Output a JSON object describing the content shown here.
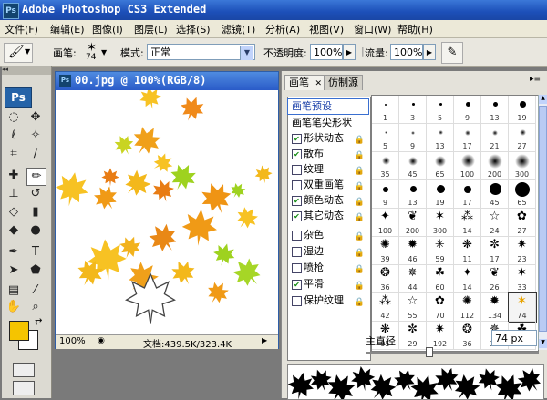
{
  "titlebar": {
    "logo": "Ps",
    "title": "Adobe Photoshop CS3 Extended"
  },
  "menu": [
    "文件(F)",
    "编辑(E)",
    "图像(I)",
    "图层(L)",
    "选择(S)",
    "滤镜(T)",
    "分析(A)",
    "视图(V)",
    "窗口(W)",
    "帮助(H)"
  ],
  "options": {
    "brush_label": "画笔:",
    "brush_size": "74",
    "mode_label": "模式:",
    "mode_value": "正常",
    "opacity_label": "不透明度:",
    "opacity_value": "100%",
    "flow_label": "流量:",
    "flow_value": "100%"
  },
  "toolbox": {
    "logo": "Ps"
  },
  "document": {
    "title": "00.jpg @ 100%(RGB/8)",
    "zoom": "100%",
    "doc_size": "文档:439.5K/323.4K"
  },
  "brush_panel": {
    "tabs": [
      "画笔",
      "仿制源"
    ],
    "list": [
      {
        "label": "画笔预设",
        "checkbox": false,
        "checked": false,
        "lock": false,
        "selected": true
      },
      {
        "label": "画笔笔尖形状",
        "checkbox": false,
        "checked": false,
        "lock": false
      },
      {
        "label": "形状动态",
        "checkbox": true,
        "checked": true,
        "lock": true
      },
      {
        "label": "散布",
        "checkbox": true,
        "checked": true,
        "lock": true
      },
      {
        "label": "纹理",
        "checkbox": true,
        "checked": false,
        "lock": true
      },
      {
        "label": "双重画笔",
        "checkbox": true,
        "checked": false,
        "lock": true
      },
      {
        "label": "颜色动态",
        "checkbox": true,
        "checked": true,
        "lock": true
      },
      {
        "label": "其它动态",
        "checkbox": true,
        "checked": true,
        "lock": true
      },
      {
        "label": "杂色",
        "checkbox": true,
        "checked": false,
        "lock": true
      },
      {
        "label": "湿边",
        "checkbox": true,
        "checked": false,
        "lock": true
      },
      {
        "label": "喷枪",
        "checkbox": true,
        "checked": false,
        "lock": true
      },
      {
        "label": "平滑",
        "checkbox": true,
        "checked": true,
        "lock": true
      },
      {
        "label": "保护纹理",
        "checkbox": true,
        "checked": false,
        "lock": true
      }
    ],
    "presets": [
      "1",
      "3",
      "5",
      "9",
      "13",
      "19",
      "5",
      "9",
      "13",
      "17",
      "21",
      "27",
      "35",
      "45",
      "65",
      "100",
      "200",
      "300",
      "9",
      "13",
      "19",
      "17",
      "45",
      "65",
      "100",
      "200",
      "300",
      "14",
      "24",
      "27",
      "39",
      "46",
      "59",
      "11",
      "17",
      "23",
      "36",
      "44",
      "60",
      "14",
      "26",
      "33",
      "42",
      "55",
      "70",
      "112",
      "134",
      "74",
      "95",
      "29",
      "192",
      "36",
      "36",
      "33"
    ],
    "master_diameter_label": "主直径",
    "master_diameter_value": "74 px"
  }
}
